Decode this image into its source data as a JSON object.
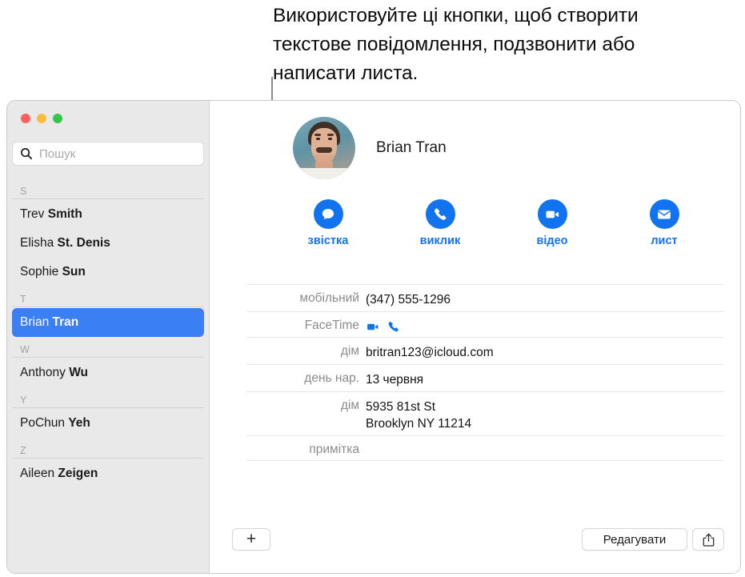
{
  "callout": {
    "text": "Використовуйте ці кнопки, щоб створити текстове повідомлення, подзвонити або написати листа."
  },
  "window": {
    "traffic_lights": {
      "close_color": "#fc615d",
      "minimize_color": "#fdbc40",
      "zoom_color": "#34c84a"
    }
  },
  "sidebar": {
    "search": {
      "placeholder": "Пошук",
      "value": "",
      "icon": "search-icon"
    },
    "sections": [
      {
        "letter": "S",
        "contacts": [
          {
            "first": "Trev ",
            "last": "Smith",
            "selected": false
          },
          {
            "first": "Elisha ",
            "last": "St. Denis",
            "selected": false
          },
          {
            "first": "Sophie ",
            "last": "Sun",
            "selected": false
          }
        ]
      },
      {
        "letter": "T",
        "contacts": [
          {
            "first": "Brian ",
            "last": "Tran",
            "selected": true
          }
        ]
      },
      {
        "letter": "W",
        "contacts": [
          {
            "first": "Anthony ",
            "last": "Wu",
            "selected": false
          }
        ]
      },
      {
        "letter": "Y",
        "contacts": [
          {
            "first": "PoChun ",
            "last": "Yeh",
            "selected": false
          }
        ]
      },
      {
        "letter": "Z",
        "contacts": [
          {
            "first": "Aileen ",
            "last": "Zeigen",
            "selected": false
          }
        ]
      }
    ]
  },
  "detail": {
    "contact_name": "Brian Tran",
    "avatar": "contact-photo",
    "accent_color": "#1273f0",
    "actions": [
      {
        "label": "звістка",
        "icon": "message-bubble-icon"
      },
      {
        "label": "виклик",
        "icon": "phone-icon"
      },
      {
        "label": "відео",
        "icon": "video-camera-icon"
      },
      {
        "label": "лист",
        "icon": "envelope-icon"
      }
    ],
    "fields": [
      {
        "label": "мобільний",
        "value": "(347) 555-1296",
        "type": "text"
      },
      {
        "label": "FaceTime",
        "value": "",
        "type": "icons",
        "icons": [
          "video-camera-icon",
          "phone-icon"
        ]
      },
      {
        "label": "дім",
        "value": "britran123@icloud.com",
        "type": "text"
      },
      {
        "label": "день нар.",
        "value": "13 червня",
        "type": "text"
      },
      {
        "label": "дім",
        "value": "5935 81st St",
        "value2": "Brooklyn NY 11214",
        "type": "multiline"
      },
      {
        "label": "примітка",
        "value": "",
        "type": "text"
      }
    ]
  },
  "bottom_bar": {
    "add_label": "+",
    "add_icon": "plus-icon",
    "edit_label": "Редагувати",
    "share_icon": "share-icon"
  }
}
